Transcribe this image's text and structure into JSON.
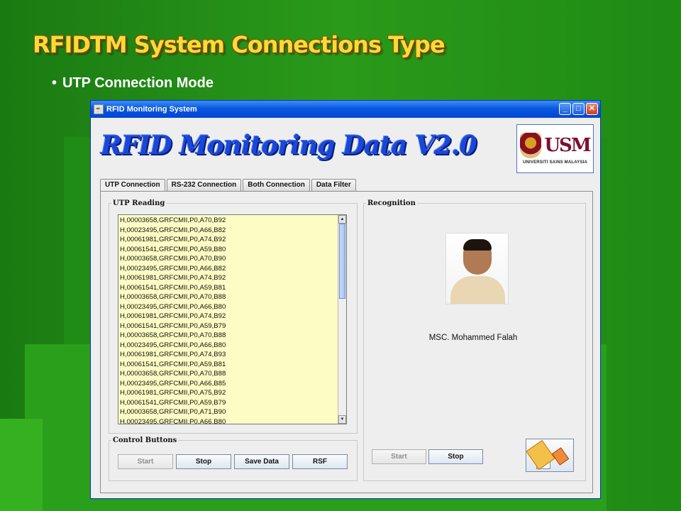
{
  "slide": {
    "title": "RFIDTM System Connections Type",
    "bullet": "UTP Connection Mode"
  },
  "window": {
    "title": "RFID Monitoring System",
    "header_title": "RFID Monitoring Data V2.0",
    "logo": {
      "mark": "USM",
      "caption": "UNIVERSITI SAINS MALAYSIA"
    }
  },
  "tabs": [
    {
      "label": "UTP Connection",
      "active": true
    },
    {
      "label": "RS-232 Connection",
      "active": false
    },
    {
      "label": "Both Connection",
      "active": false
    },
    {
      "label": "Data Filter",
      "active": false
    }
  ],
  "utp_reading": {
    "label": "UTP Reading",
    "lines": [
      "H,00003658,GRFCMII,P0,A70,B92",
      "H,00023495,GRFCMII,P0,A66,B82",
      "H,00061981,GRFCMII,P0,A74,B92",
      "H,00061541,GRFCMII,P0,A59,B80",
      "H,00003658,GRFCMII,P0,A70,B90",
      "H,00023495,GRFCMII,P0,A66,B82",
      "H,00061981,GRFCMII,P0,A74,B92",
      "H,00061541,GRFCMII,P0,A59,B81",
      "H,00003658,GRFCMII,P0,A70,B88",
      "H,00023495,GRFCMII,P0,A66,B80",
      "H,00061981,GRFCMII,P0,A74,B92",
      "H,00061541,GRFCMII,P0,A59,B79",
      "H,00003658,GRFCMII,P0,A70,B88",
      "H,00023495,GRFCMII,P0,A66,B80",
      "H,00061981,GRFCMII,P0,A74,B93",
      "H,00061541,GRFCMII,P0,A59,B81",
      "H,00003658,GRFCMII,P0,A70,B88",
      "H,00023495,GRFCMII,P0,A66,B85",
      "H,00061981,GRFCMII,P0,A75,B92",
      "H,00061541,GRFCMII,P0,A59,B79",
      "H,00003658,GRFCMII,P0,A71,B90",
      "H,00023495,GRFCMII,P0,A66,B80"
    ]
  },
  "control": {
    "label": "Control Buttons",
    "start": "Start",
    "stop": "Stop",
    "save": "Save Data",
    "rsf": "RSF"
  },
  "recognition": {
    "label": "Recognition",
    "name": "MSC. Mohammed Falah",
    "start": "Start",
    "stop": "Stop"
  }
}
